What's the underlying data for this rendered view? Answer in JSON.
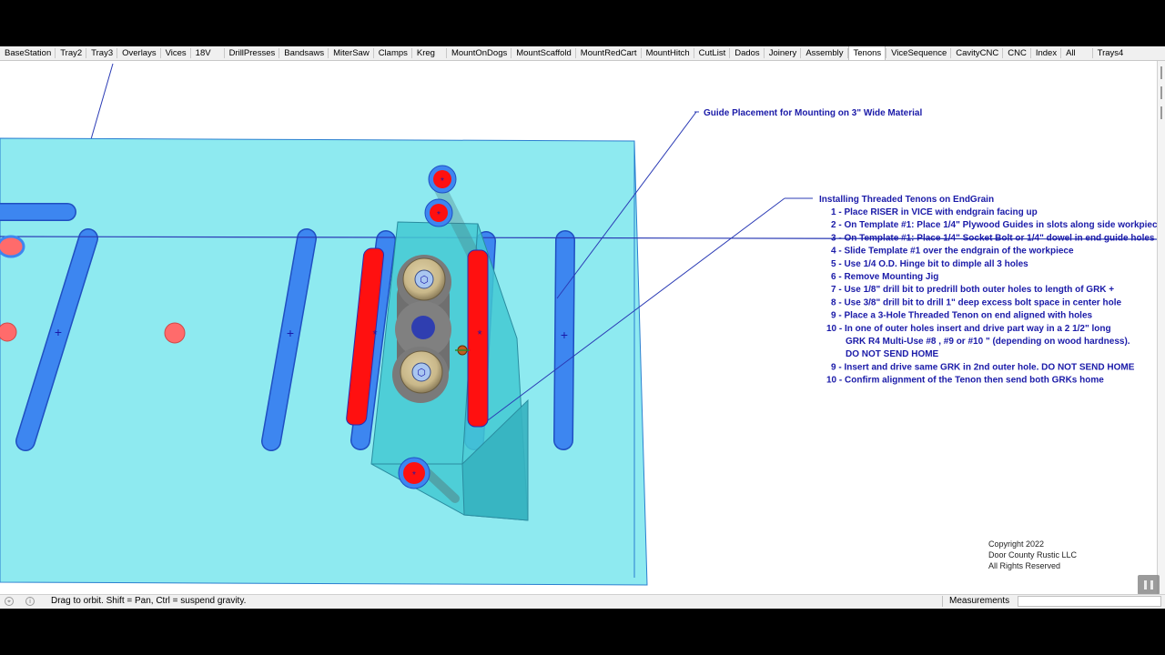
{
  "tabs": [
    "BaseStation",
    "Tray2",
    "Tray3",
    "Overlays",
    "Vices",
    "18V",
    "DrillPresses",
    "Bandsaws",
    "MiterSaw",
    "Clamps",
    "Kreg",
    "MountOnDogs",
    "MountScaffold",
    "MountRedCart",
    "MountHitch",
    "CutList",
    "Dados",
    "Joinery",
    "Assembly",
    "Tenons",
    "ViceSequence",
    "CavityCNC",
    "CNC",
    "Index",
    "All",
    "Trays4"
  ],
  "active_tab": "Tenons",
  "annotations": {
    "guide_label": "Guide Placement for Mounting on 3\" Wide Material",
    "install_title": "Installing Threaded Tenons on EndGrain",
    "steps": [
      "1 - Place RISER in VICE with endgrain facing up",
      "2 - On Template #1: Place 1/4\" Plywood Guides in slots along side workpiec",
      "3 - On Template #1: Place 1/4\" Socket Bolt or 1/4\" dowel in end guide holes",
      "4 - Slide Template #1 over the endgrain of the workpiece",
      "5 - Use 1/4 O.D. Hinge bit to dimple all 3 holes",
      "6 - Remove Mounting Jig",
      "7 - Use 1/8\" drill bit to predrill both outer holes to length of GRK +",
      "8 - Use 3/8\" drill bit to drill 1\" deep excess bolt space in center hole",
      "9 - Place a 3-Hole Threaded Tenon on end aligned with holes",
      "10 - In one of outer holes insert and drive part way in a 2 1/2\" long",
      "GRK R4 Multi-Use #8 , #9 or #10 \" (depending on wood hardness).",
      "DO NOT SEND HOME",
      "9 - Insert and drive same GRK in 2nd outer hole. DO NOT SEND HOME",
      "10 - Confirm alignment of the Tenon then send both GRKs home"
    ]
  },
  "copyright": [
    "Copyright 2022",
    "Door County Rustic LLC",
    "All Rights Reserved"
  ],
  "status": {
    "hint": "Drag to orbit. Shift = Pan, Ctrl = suspend gravity.",
    "measurements_label": "Measurements",
    "measurements_value": ""
  },
  "colors": {
    "plate": "#8eeaf0",
    "plate_edge": "#2a7fd0",
    "slot": "#3d86f0",
    "guide": "#ff1010",
    "marker": "#ff6b6b",
    "annotation": "#1a1aa8"
  }
}
